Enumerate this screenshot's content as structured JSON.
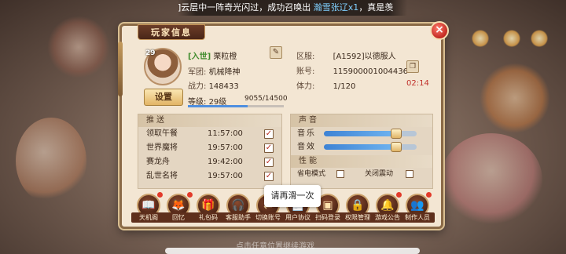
{
  "marquee": {
    "prefix": "]云层中一阵奇光闪过，成功召唤出 ",
    "highlight": "瀚雪张辽x1",
    "suffix": "，真是羡"
  },
  "popup": {
    "title": "玩家信息",
    "close": "×"
  },
  "player": {
    "avatar_level": "29",
    "guild_tag": "[入世]",
    "name": "栗粒橙",
    "rank_label": "军团: ",
    "rank_value": "机械降神",
    "power_label": "战力: ",
    "power_value": "148433",
    "level_label": "等级: ",
    "level_value": "29级",
    "exp_text": "9055/14500",
    "exp_progress": 0.62
  },
  "account": {
    "server_label": "区服:",
    "server_value": "[A1592]以德服人",
    "account_label": "账号:",
    "account_value": "115900001004436",
    "stamina_label": "体力:",
    "stamina_value": "1/120",
    "timer": "02:14"
  },
  "settings_button": "设置",
  "push": {
    "title": "推送",
    "items": [
      {
        "name": "领取午餐",
        "time": "11:57:00",
        "checked": "✓"
      },
      {
        "name": "世界魔将",
        "time": "19:57:00",
        "checked": "✓"
      },
      {
        "name": "赛龙舟",
        "time": "19:42:00",
        "checked": "✓"
      },
      {
        "name": "乱世名将",
        "time": "19:57:00",
        "checked": "✓"
      }
    ]
  },
  "sound": {
    "title": "声音",
    "music_label": "音乐",
    "music_level": 0.78,
    "effects_label": "音效",
    "effects_level": 0.78
  },
  "performance": {
    "title": "性能",
    "option1": "省电模式",
    "option2": "关闭震动"
  },
  "icons": [
    {
      "label": "天机阁",
      "icon": "book-icon",
      "glyph": "📖",
      "badge": true
    },
    {
      "label": "回忆",
      "icon": "fox-icon",
      "glyph": "🦊",
      "badge": true
    },
    {
      "label": "礼包码",
      "icon": "gift-icon",
      "glyph": "🎁",
      "badge": false
    },
    {
      "label": "客服助手",
      "icon": "headset-icon",
      "glyph": "🎧",
      "badge": false
    },
    {
      "label": "切换账号",
      "icon": "switch-icon",
      "glyph": "⇄",
      "badge": false
    },
    {
      "label": "用户协议",
      "icon": "document-icon",
      "glyph": "📄",
      "badge": false
    },
    {
      "label": "扫码登录",
      "icon": "scan-icon",
      "glyph": "▣",
      "badge": false
    },
    {
      "label": "权限管理",
      "icon": "lock-icon",
      "glyph": "🔒",
      "badge": false
    },
    {
      "label": "游戏公告",
      "icon": "bell-icon",
      "glyph": "🔔",
      "badge": true
    },
    {
      "label": "制作人员",
      "icon": "people-icon",
      "glyph": "👥",
      "badge": true
    }
  ],
  "toast": "请再滑一次",
  "hint": "点击任意位置继续游戏"
}
